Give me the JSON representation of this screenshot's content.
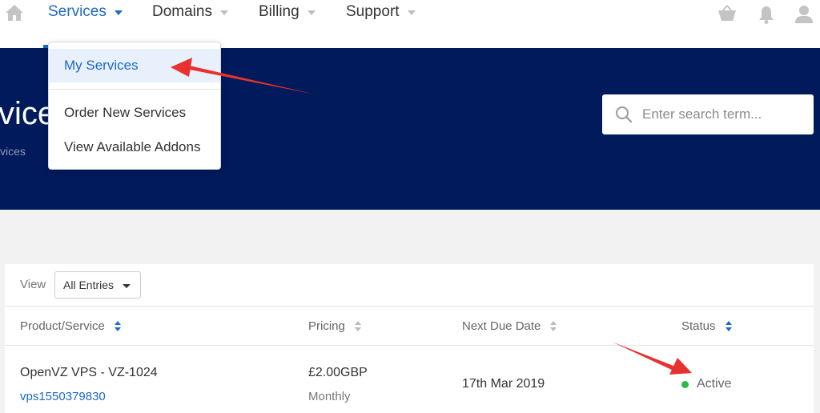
{
  "nav": {
    "items": [
      {
        "label": "Services"
      },
      {
        "label": "Domains"
      },
      {
        "label": "Billing"
      },
      {
        "label": "Support"
      }
    ],
    "active_color": "#1e68c7",
    "icons": [
      "home-icon",
      "cart-icon",
      "bell-icon",
      "user-icon"
    ]
  },
  "dropdown": {
    "items": [
      {
        "label": "My Services"
      },
      {
        "label": "Order New Services"
      },
      {
        "label": "View Available Addons"
      }
    ]
  },
  "hero": {
    "title_fragment": "vice",
    "breadcrumb_fragment": "vices",
    "background": "#001a5c"
  },
  "search": {
    "placeholder": "Enter search term..."
  },
  "table": {
    "view_label": "View",
    "view_value": "All Entries",
    "headers": [
      "Product/Service",
      "Pricing",
      "Next Due Date",
      "Status"
    ],
    "rows": [
      {
        "product": "OpenVZ VPS - VZ-1024",
        "domain": "vps1550379830",
        "price": "£2.00GBP",
        "cycle": "Monthly",
        "due": "17th Mar 2019",
        "status": "Active",
        "status_color": "#2fb84a"
      }
    ]
  },
  "annotations": {
    "arrow_color": "#e8322f"
  }
}
